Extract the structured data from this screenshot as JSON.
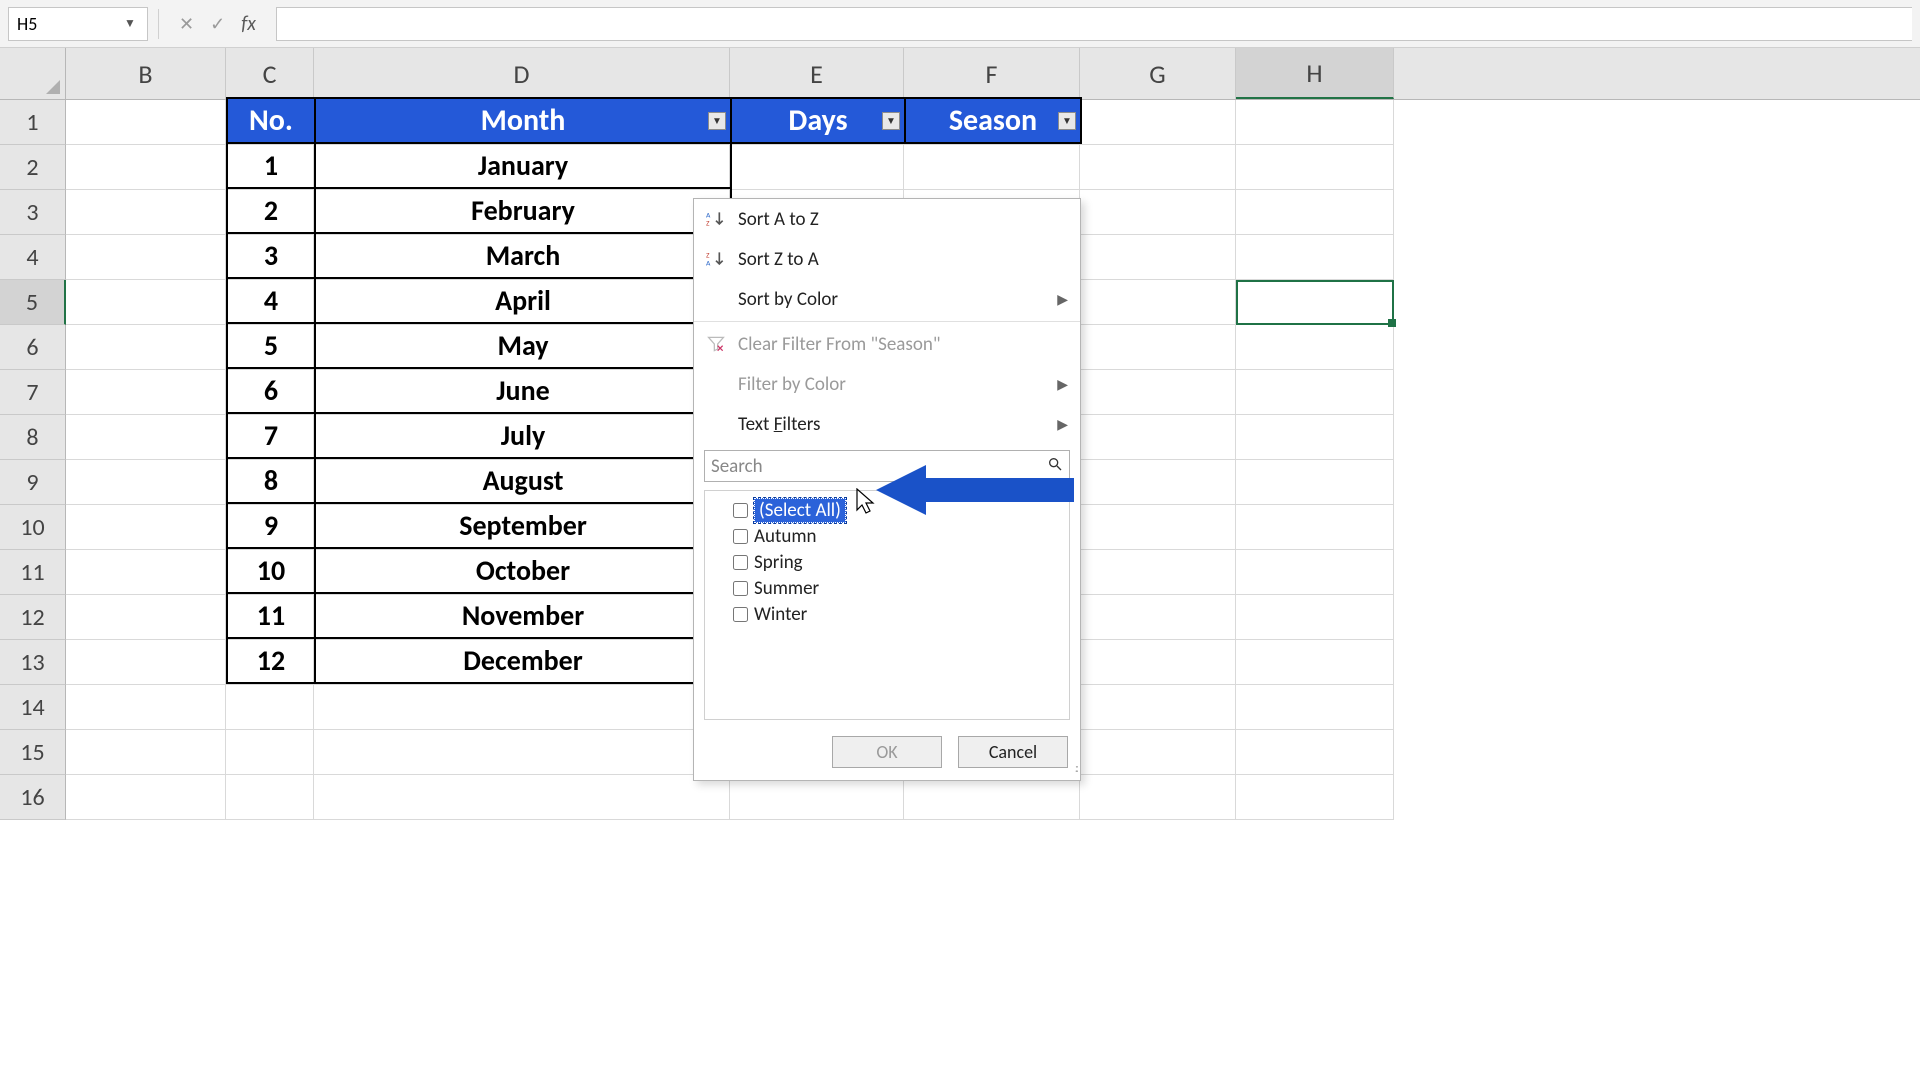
{
  "name_box": "H5",
  "formula": "",
  "columns": [
    "B",
    "C",
    "D",
    "E",
    "F",
    "G",
    "H"
  ],
  "row_numbers": [
    1,
    2,
    3,
    4,
    5,
    6,
    7,
    8,
    9,
    10,
    11,
    12,
    13,
    14,
    15,
    16
  ],
  "selected_cell": "H5",
  "table": {
    "headers": {
      "no": "No.",
      "month": "Month",
      "days": "Days",
      "season": "Season"
    },
    "rows": [
      {
        "no": 1,
        "month": "January"
      },
      {
        "no": 2,
        "month": "February"
      },
      {
        "no": 3,
        "month": "March"
      },
      {
        "no": 4,
        "month": "April"
      },
      {
        "no": 5,
        "month": "May"
      },
      {
        "no": 6,
        "month": "June"
      },
      {
        "no": 7,
        "month": "July"
      },
      {
        "no": 8,
        "month": "August"
      },
      {
        "no": 9,
        "month": "September"
      },
      {
        "no": 10,
        "month": "October"
      },
      {
        "no": 11,
        "month": "November"
      },
      {
        "no": 12,
        "month": "December"
      }
    ]
  },
  "filter_menu": {
    "sort_asc": "Sort A to Z",
    "sort_desc": "Sort Z to A",
    "sort_color": "Sort by Color",
    "clear": "Clear Filter From \"Season\"",
    "filter_color": "Filter by Color",
    "text_filters": "Text Filters",
    "search_placeholder": "Search",
    "select_all": "(Select All)",
    "options": [
      "Autumn",
      "Spring",
      "Summer",
      "Winter"
    ],
    "ok": "OK",
    "cancel": "Cancel"
  }
}
